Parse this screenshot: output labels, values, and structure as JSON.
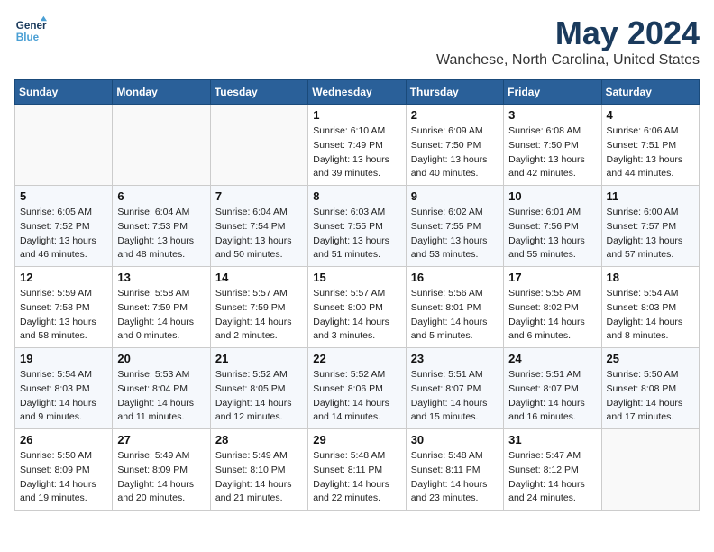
{
  "logo": {
    "line1": "General",
    "line2": "Blue"
  },
  "header": {
    "month": "May 2024",
    "location": "Wanchese, North Carolina, United States"
  },
  "weekdays": [
    "Sunday",
    "Monday",
    "Tuesday",
    "Wednesday",
    "Thursday",
    "Friday",
    "Saturday"
  ],
  "weeks": [
    [
      {
        "day": "",
        "info": ""
      },
      {
        "day": "",
        "info": ""
      },
      {
        "day": "",
        "info": ""
      },
      {
        "day": "1",
        "info": "Sunrise: 6:10 AM\nSunset: 7:49 PM\nDaylight: 13 hours\nand 39 minutes."
      },
      {
        "day": "2",
        "info": "Sunrise: 6:09 AM\nSunset: 7:50 PM\nDaylight: 13 hours\nand 40 minutes."
      },
      {
        "day": "3",
        "info": "Sunrise: 6:08 AM\nSunset: 7:50 PM\nDaylight: 13 hours\nand 42 minutes."
      },
      {
        "day": "4",
        "info": "Sunrise: 6:06 AM\nSunset: 7:51 PM\nDaylight: 13 hours\nand 44 minutes."
      }
    ],
    [
      {
        "day": "5",
        "info": "Sunrise: 6:05 AM\nSunset: 7:52 PM\nDaylight: 13 hours\nand 46 minutes."
      },
      {
        "day": "6",
        "info": "Sunrise: 6:04 AM\nSunset: 7:53 PM\nDaylight: 13 hours\nand 48 minutes."
      },
      {
        "day": "7",
        "info": "Sunrise: 6:04 AM\nSunset: 7:54 PM\nDaylight: 13 hours\nand 50 minutes."
      },
      {
        "day": "8",
        "info": "Sunrise: 6:03 AM\nSunset: 7:55 PM\nDaylight: 13 hours\nand 51 minutes."
      },
      {
        "day": "9",
        "info": "Sunrise: 6:02 AM\nSunset: 7:55 PM\nDaylight: 13 hours\nand 53 minutes."
      },
      {
        "day": "10",
        "info": "Sunrise: 6:01 AM\nSunset: 7:56 PM\nDaylight: 13 hours\nand 55 minutes."
      },
      {
        "day": "11",
        "info": "Sunrise: 6:00 AM\nSunset: 7:57 PM\nDaylight: 13 hours\nand 57 minutes."
      }
    ],
    [
      {
        "day": "12",
        "info": "Sunrise: 5:59 AM\nSunset: 7:58 PM\nDaylight: 13 hours\nand 58 minutes."
      },
      {
        "day": "13",
        "info": "Sunrise: 5:58 AM\nSunset: 7:59 PM\nDaylight: 14 hours\nand 0 minutes."
      },
      {
        "day": "14",
        "info": "Sunrise: 5:57 AM\nSunset: 7:59 PM\nDaylight: 14 hours\nand 2 minutes."
      },
      {
        "day": "15",
        "info": "Sunrise: 5:57 AM\nSunset: 8:00 PM\nDaylight: 14 hours\nand 3 minutes."
      },
      {
        "day": "16",
        "info": "Sunrise: 5:56 AM\nSunset: 8:01 PM\nDaylight: 14 hours\nand 5 minutes."
      },
      {
        "day": "17",
        "info": "Sunrise: 5:55 AM\nSunset: 8:02 PM\nDaylight: 14 hours\nand 6 minutes."
      },
      {
        "day": "18",
        "info": "Sunrise: 5:54 AM\nSunset: 8:03 PM\nDaylight: 14 hours\nand 8 minutes."
      }
    ],
    [
      {
        "day": "19",
        "info": "Sunrise: 5:54 AM\nSunset: 8:03 PM\nDaylight: 14 hours\nand 9 minutes."
      },
      {
        "day": "20",
        "info": "Sunrise: 5:53 AM\nSunset: 8:04 PM\nDaylight: 14 hours\nand 11 minutes."
      },
      {
        "day": "21",
        "info": "Sunrise: 5:52 AM\nSunset: 8:05 PM\nDaylight: 14 hours\nand 12 minutes."
      },
      {
        "day": "22",
        "info": "Sunrise: 5:52 AM\nSunset: 8:06 PM\nDaylight: 14 hours\nand 14 minutes."
      },
      {
        "day": "23",
        "info": "Sunrise: 5:51 AM\nSunset: 8:07 PM\nDaylight: 14 hours\nand 15 minutes."
      },
      {
        "day": "24",
        "info": "Sunrise: 5:51 AM\nSunset: 8:07 PM\nDaylight: 14 hours\nand 16 minutes."
      },
      {
        "day": "25",
        "info": "Sunrise: 5:50 AM\nSunset: 8:08 PM\nDaylight: 14 hours\nand 17 minutes."
      }
    ],
    [
      {
        "day": "26",
        "info": "Sunrise: 5:50 AM\nSunset: 8:09 PM\nDaylight: 14 hours\nand 19 minutes."
      },
      {
        "day": "27",
        "info": "Sunrise: 5:49 AM\nSunset: 8:09 PM\nDaylight: 14 hours\nand 20 minutes."
      },
      {
        "day": "28",
        "info": "Sunrise: 5:49 AM\nSunset: 8:10 PM\nDaylight: 14 hours\nand 21 minutes."
      },
      {
        "day": "29",
        "info": "Sunrise: 5:48 AM\nSunset: 8:11 PM\nDaylight: 14 hours\nand 22 minutes."
      },
      {
        "day": "30",
        "info": "Sunrise: 5:48 AM\nSunset: 8:11 PM\nDaylight: 14 hours\nand 23 minutes."
      },
      {
        "day": "31",
        "info": "Sunrise: 5:47 AM\nSunset: 8:12 PM\nDaylight: 14 hours\nand 24 minutes."
      },
      {
        "day": "",
        "info": ""
      }
    ]
  ]
}
